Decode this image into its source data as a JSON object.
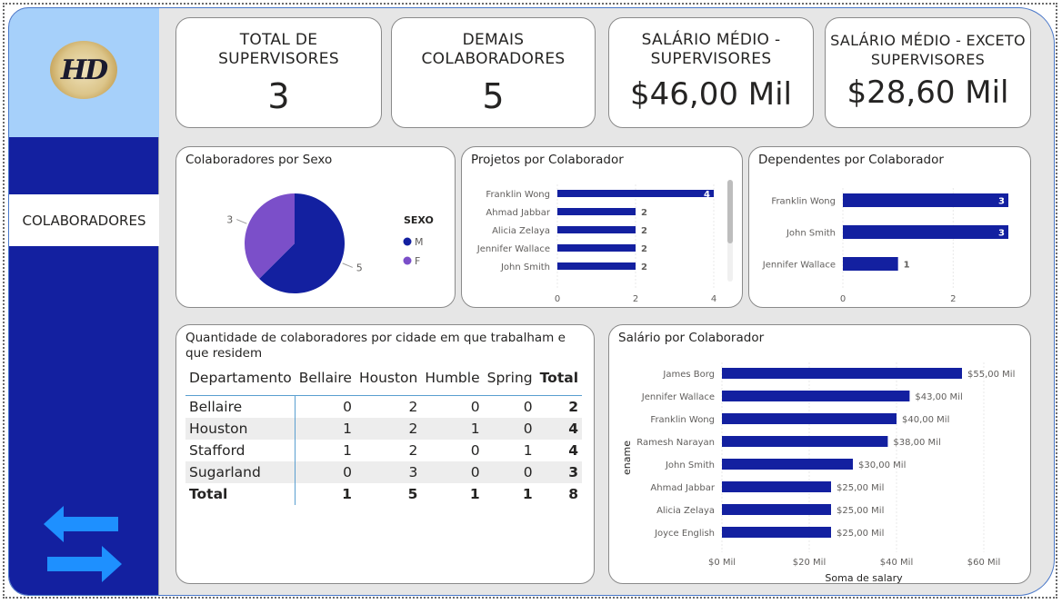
{
  "sidebar": {
    "logo_text": "HD",
    "nav_item": "COLABORADORES",
    "nav_icon": "swap-arrows-icon"
  },
  "kpis": [
    {
      "title": "TOTAL DE SUPERVISORES",
      "value": "3"
    },
    {
      "title": "DEMAIS COLABORADORES",
      "value": "5"
    },
    {
      "title": "SALÁRIO MÉDIO - SUPERVISORES",
      "value": "$46,00 Mil"
    },
    {
      "title": "SALÁRIO MÉDIO - EXCETO SUPERVISORES",
      "value": "$28,60 Mil"
    }
  ],
  "colors": {
    "primary_bar": "#1320a0",
    "secondary_slice": "#7b4fc9",
    "sidebar": "#1320a0",
    "logo_bg": "#a6d0fa",
    "arrow": "#1e90ff"
  },
  "pie": {
    "title": "Colaboradores por Sexo",
    "legend_title": "SEXO"
  },
  "projetos": {
    "title": "Projetos por Colaborador"
  },
  "dependentes": {
    "title": "Dependentes por Colaborador"
  },
  "salario": {
    "title": "Salário por Colaborador"
  },
  "matrix": {
    "title": "Quantidade de colaboradores por cidade em que trabalham e que residem",
    "columns": [
      "Departamento",
      "Bellaire",
      "Houston",
      "Humble",
      "Spring",
      "Total"
    ],
    "rows": [
      [
        "Bellaire",
        "0",
        "2",
        "0",
        "0",
        "2"
      ],
      [
        "Houston",
        "1",
        "2",
        "1",
        "0",
        "4"
      ],
      [
        "Stafford",
        "1",
        "2",
        "0",
        "1",
        "4"
      ],
      [
        "Sugarland",
        "0",
        "3",
        "0",
        "0",
        "3"
      ]
    ],
    "total_row": [
      "Total",
      "1",
      "5",
      "1",
      "1",
      "8"
    ]
  },
  "chart_data": [
    {
      "type": "pie",
      "title": "Colaboradores por Sexo",
      "legend_title": "SEXO",
      "categories": [
        "M",
        "F"
      ],
      "values": [
        5,
        3
      ],
      "colors": [
        "#1320a0",
        "#7b4fc9"
      ],
      "legend_placement": "right"
    },
    {
      "type": "bar",
      "orientation": "horizontal",
      "title": "Projetos por Colaborador",
      "categories": [
        "Franklin Wong",
        "Ahmad Jabbar",
        "Alicia Zelaya",
        "Jennifer Wallace",
        "John Smith"
      ],
      "values": [
        4,
        2,
        2,
        2,
        2
      ],
      "xlim": [
        0,
        4
      ],
      "xticks": [
        "0",
        "2",
        "4"
      ],
      "grid": true
    },
    {
      "type": "bar",
      "orientation": "horizontal",
      "title": "Dependentes por Colaborador",
      "categories": [
        "Franklin Wong",
        "John Smith",
        "Jennifer Wallace"
      ],
      "values": [
        3,
        3,
        1
      ],
      "xlim": [
        0,
        3
      ],
      "xticks": [
        "0",
        "2"
      ],
      "grid": true
    },
    {
      "type": "bar",
      "orientation": "horizontal",
      "title": "Salário por Colaborador",
      "xlabel": "Soma de salary",
      "ylabel": "ename",
      "categories": [
        "James Borg",
        "Jennifer Wallace",
        "Franklin Wong",
        "Ramesh Narayan",
        "John Smith",
        "Ahmad Jabbar",
        "Alicia Zelaya",
        "Joyce English"
      ],
      "values": [
        55,
        43,
        40,
        38,
        30,
        25,
        25,
        25
      ],
      "value_labels": [
        "$55,00 Mil",
        "$43,00 Mil",
        "$40,00 Mil",
        "$38,00 Mil",
        "$30,00 Mil",
        "$25,00 Mil",
        "$25,00 Mil",
        "$25,00 Mil"
      ],
      "xlim": [
        0,
        60
      ],
      "xticks": [
        "$0 Mil",
        "$20 Mil",
        "$40 Mil",
        "$60 Mil"
      ],
      "grid": true
    }
  ]
}
